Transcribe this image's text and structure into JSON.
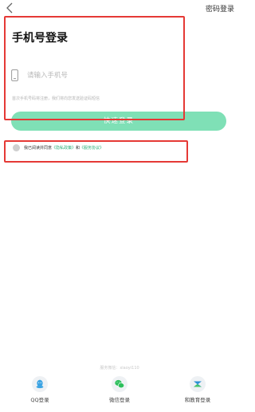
{
  "header": {
    "password_login_label": "密码登录"
  },
  "form": {
    "title": "手机号登录",
    "phone_placeholder": "请输入手机号",
    "hint": "首次手机号码将注册，我们将向您发送验证码短信",
    "submit_label": "快速登录"
  },
  "agreement": {
    "prefix": "我已阅读并同意",
    "privacy_link": "《隐私政策》",
    "conjunction": "和",
    "service_link": "《服务协议》",
    "checked": false
  },
  "footer": {
    "wechat_hint": "服务微信：xiaoyi110",
    "options": [
      {
        "label": "QQ登录",
        "icon": "qq-icon"
      },
      {
        "label": "微信登录",
        "icon": "wechat-icon"
      },
      {
        "label": "和教育登录",
        "icon": "hejiaoyu-icon"
      }
    ]
  },
  "colors": {
    "accent_green": "#7fe0b6",
    "link_green": "#2db07a",
    "highlight_red": "#e53935"
  }
}
